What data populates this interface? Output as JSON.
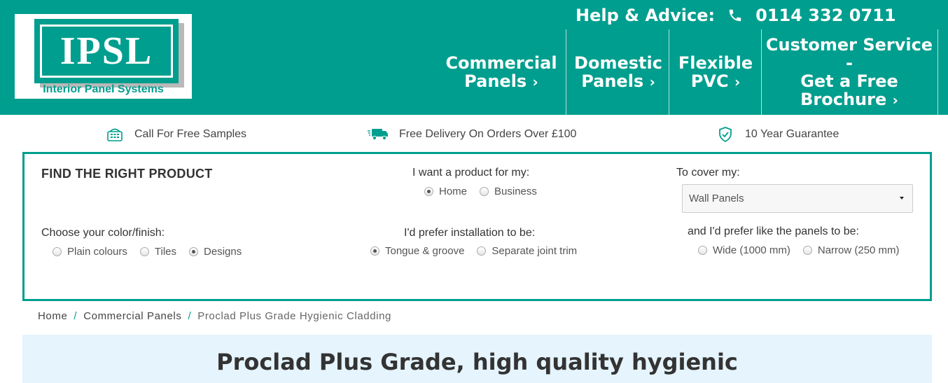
{
  "logo": {
    "text": "IPSL",
    "subtitle": "Interior Panel Systems"
  },
  "header": {
    "help_label": "Help & Advice:",
    "phone": "0114 332 0711",
    "nav": [
      {
        "line1": "Commercial",
        "line2": "Panels",
        "chevron": "›"
      },
      {
        "line1": "Domestic",
        "line2": "Panels",
        "chevron": "›"
      },
      {
        "line1": "Flexible",
        "line2": "PVC",
        "chevron": "›"
      },
      {
        "line1": "Customer Service -",
        "line2": "Get a Free",
        "line3": "Brochure",
        "chevron": "›"
      }
    ]
  },
  "benefits": [
    {
      "icon": "phone-samples-icon",
      "text": "Call For Free Samples"
    },
    {
      "icon": "delivery-truck-icon",
      "text": "Free Delivery On Orders Over £100"
    },
    {
      "icon": "shield-check-icon",
      "text": "10 Year Guarantee"
    }
  ],
  "finder": {
    "title": "FIND THE RIGHT PRODUCT",
    "purpose": {
      "label": "I want a product for my:",
      "options": [
        "Home",
        "Business"
      ],
      "selected": "Home"
    },
    "cover": {
      "label": "To cover my:",
      "value": "Wall Panels"
    },
    "finish": {
      "label": "Choose your color/finish:",
      "options": [
        "Plain colours",
        "Tiles",
        "Designs"
      ],
      "selected": "Designs"
    },
    "installation": {
      "label": "I'd prefer installation to be:",
      "options": [
        "Tongue & groove",
        "Separate joint trim"
      ],
      "selected": "Tongue & groove"
    },
    "width": {
      "label": "and I'd prefer like the panels to be:",
      "options": [
        "Wide (1000 mm)",
        "Narrow (250 mm)"
      ],
      "selected": ""
    }
  },
  "breadcrumb": {
    "items": [
      "Home",
      "Commercial Panels"
    ],
    "separator": "/",
    "current": "Proclad Plus Grade Hygienic Cladding"
  },
  "hero": {
    "title": "Proclad Plus Grade, high quality hygienic"
  },
  "colors": {
    "brand": "#009e8e",
    "hero_bg": "#e5f4fd"
  }
}
